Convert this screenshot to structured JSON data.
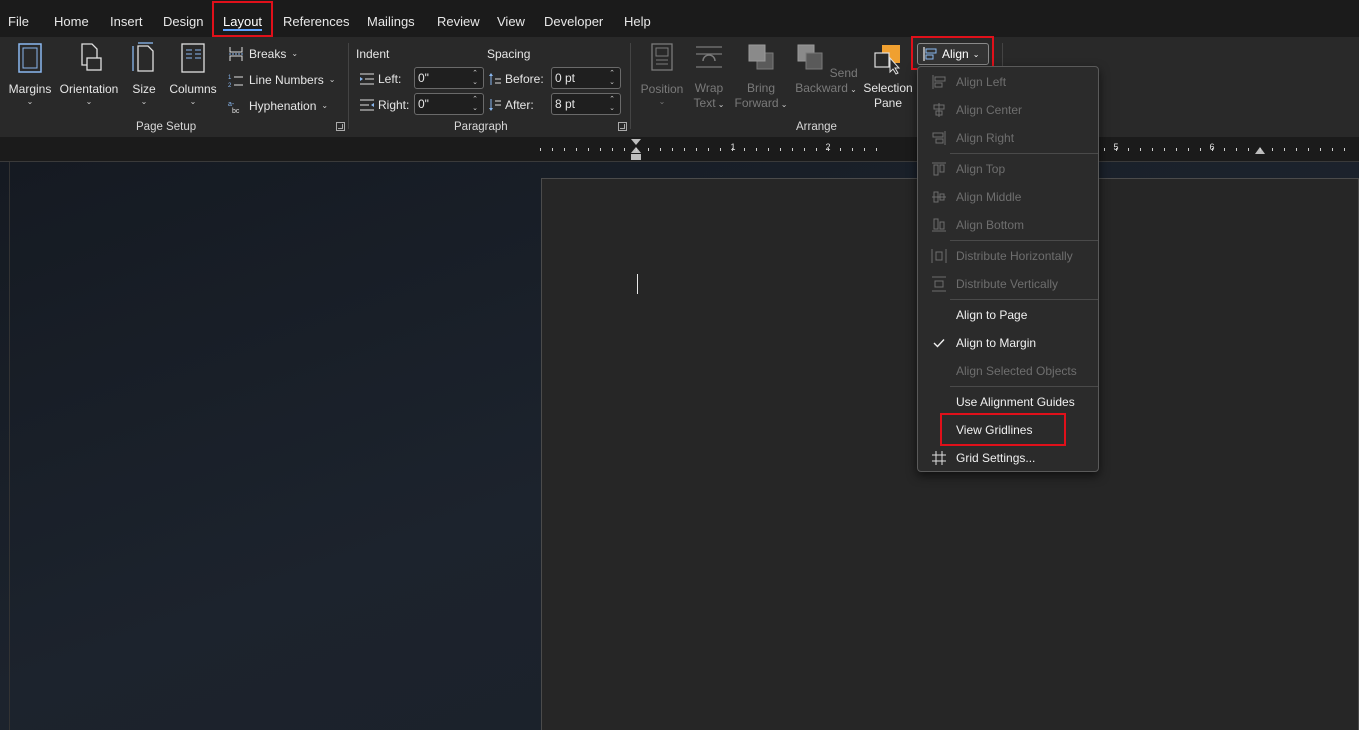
{
  "tabs": [
    {
      "label": "File"
    },
    {
      "label": "Home"
    },
    {
      "label": "Insert"
    },
    {
      "label": "Design"
    },
    {
      "label": "Layout"
    },
    {
      "label": "References"
    },
    {
      "label": "Mailings"
    },
    {
      "label": "Review"
    },
    {
      "label": "View"
    },
    {
      "label": "Developer"
    },
    {
      "label": "Help"
    }
  ],
  "page_setup": {
    "margins": "Margins",
    "orientation": "Orientation",
    "size": "Size",
    "columns": "Columns",
    "breaks": "Breaks",
    "line_numbers": "Line Numbers",
    "hyphenation": "Hyphenation",
    "group_label": "Page Setup"
  },
  "paragraph": {
    "indent_label": "Indent",
    "spacing_label": "Spacing",
    "left_label": "Left:",
    "right_label": "Right:",
    "before_label": "Before:",
    "after_label": "After:",
    "left_value": "0\"",
    "right_value": "0\"",
    "before_value": "0 pt",
    "after_value": "8 pt",
    "group_label": "Paragraph"
  },
  "arrange": {
    "position": "Position",
    "wrap_text_1": "Wrap",
    "wrap_text_2": "Text",
    "bring_forward_1": "Bring",
    "bring_forward_2": "Forward",
    "send_backward_1": "Send",
    "send_backward_2": "Backward",
    "selection_pane_1": "Selection",
    "selection_pane_2": "Pane",
    "align": "Align",
    "group_label": "Arrange"
  },
  "ruler": [
    "1",
    "2",
    "5",
    "6"
  ],
  "align_menu": {
    "align_left": "Align Left",
    "align_center": "Align Center",
    "align_right": "Align Right",
    "align_top": "Align Top",
    "align_middle": "Align Middle",
    "align_bottom": "Align Bottom",
    "distribute_h": "Distribute Horizontally",
    "distribute_v": "Distribute Vertically",
    "align_to_page": "Align to Page",
    "align_to_margin": "Align to Margin",
    "align_selected": "Align Selected Objects",
    "use_guides": "Use Alignment Guides",
    "view_gridlines": "View Gridlines",
    "grid_settings": "Grid Settings..."
  },
  "colors": {
    "highlight": "#e0101a",
    "accent": "#5ea2ff",
    "selection_pane_icon": "#f0a030"
  }
}
